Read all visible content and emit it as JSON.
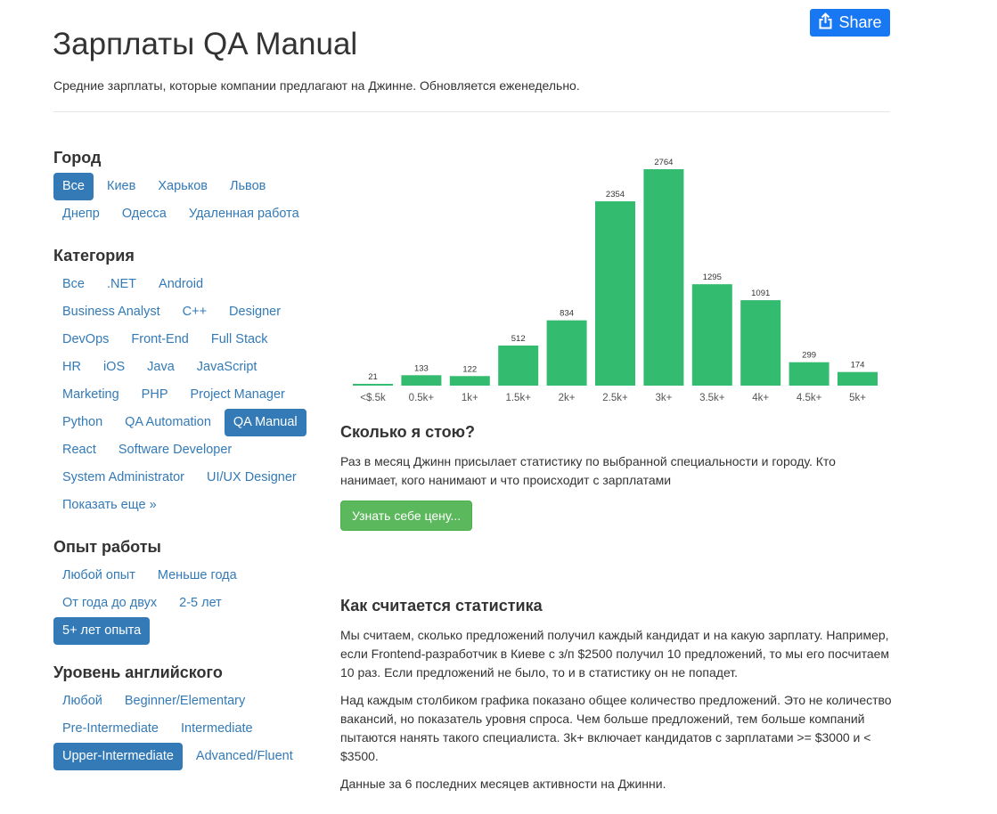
{
  "share": {
    "label": "Share",
    "icon": "share-icon"
  },
  "header": {
    "title": "Зарплаты QA Manual",
    "subtitle": "Средние зарплаты, которые компании предлагают на Джинне. Обновляется еженедельно."
  },
  "filters": {
    "city": {
      "heading": "Город",
      "items": [
        {
          "label": "Все",
          "active": true
        },
        {
          "label": "Киев",
          "active": false
        },
        {
          "label": "Харьков",
          "active": false
        },
        {
          "label": "Львов",
          "active": false
        },
        {
          "label": "Днепр",
          "active": false
        },
        {
          "label": "Одесса",
          "active": false
        },
        {
          "label": "Удаленная работа",
          "active": false
        }
      ]
    },
    "category": {
      "heading": "Категория",
      "items": [
        {
          "label": "Все",
          "active": false
        },
        {
          "label": ".NET",
          "active": false
        },
        {
          "label": "Android",
          "active": false
        },
        {
          "label": "Business Analyst",
          "active": false
        },
        {
          "label": "C++",
          "active": false
        },
        {
          "label": "Designer",
          "active": false
        },
        {
          "label": "DevOps",
          "active": false
        },
        {
          "label": "Front-End",
          "active": false
        },
        {
          "label": "Full Stack",
          "active": false
        },
        {
          "label": "HR",
          "active": false
        },
        {
          "label": "iOS",
          "active": false
        },
        {
          "label": "Java",
          "active": false
        },
        {
          "label": "JavaScript",
          "active": false
        },
        {
          "label": "Marketing",
          "active": false
        },
        {
          "label": "PHP",
          "active": false
        },
        {
          "label": "Project Manager",
          "active": false
        },
        {
          "label": "Python",
          "active": false
        },
        {
          "label": "QA Automation",
          "active": false
        },
        {
          "label": "QA Manual",
          "active": true
        },
        {
          "label": "React",
          "active": false
        },
        {
          "label": "Software Developer",
          "active": false
        },
        {
          "label": "System Administrator",
          "active": false
        },
        {
          "label": "UI/UX Designer",
          "active": false
        },
        {
          "label": "Показать еще »",
          "active": false
        }
      ]
    },
    "experience": {
      "heading": "Опыт работы",
      "items": [
        {
          "label": "Любой опыт",
          "active": false
        },
        {
          "label": "Меньше года",
          "active": false
        },
        {
          "label": "От года до двух",
          "active": false
        },
        {
          "label": "2-5 лет",
          "active": false
        },
        {
          "label": "5+ лет опыта",
          "active": true
        }
      ]
    },
    "english": {
      "heading": "Уровень английского",
      "items": [
        {
          "label": "Любой",
          "active": false
        },
        {
          "label": "Beginner/Elementary",
          "active": false
        },
        {
          "label": "Pre-Intermediate",
          "active": false
        },
        {
          "label": "Intermediate",
          "active": false
        },
        {
          "label": "Upper-Intermediate",
          "active": true
        },
        {
          "label": "Advanced/Fluent",
          "active": false
        }
      ]
    }
  },
  "chart_data": {
    "type": "bar",
    "categories": [
      "<$.5k",
      "0.5k+",
      "1k+",
      "1.5k+",
      "2k+",
      "2.5k+",
      "3k+",
      "3.5k+",
      "4k+",
      "4.5k+",
      "5k+"
    ],
    "values": [
      21,
      133,
      122,
      512,
      834,
      2354,
      2764,
      1295,
      1091,
      299,
      174
    ],
    "color": "#33bb6f",
    "title": "",
    "xlabel": "",
    "ylabel": "",
    "ylim": [
      0,
      2764
    ],
    "grid": false
  },
  "cost": {
    "heading": "Сколько я стою?",
    "text": "Раз в месяц Джинн присылает статистику по выбранной специальности и городу. Кто нанимает, кого нанимают и что происходит с зарплатами",
    "button": "Узнать себе цену..."
  },
  "method": {
    "heading": "Как считается статистика",
    "p1": "Мы считаем, сколько предложений получил каждый кандидат и на какую зарплату. Например, если Frontend-разработчик в Киеве с з/п $2500 получил 10 предложений, то мы его посчитаем 10 раз. Если предложений не было, то и в статистику он не попадет.",
    "p2": "Над каждым столбиком графика показано общее количество предложений. Это не количество вакансий, но показатель уровня спроса. Чем больше предложений, тем больше компаний пытаются нанять такого специалиста. 3k+ включает кандидатов с зарплатами >= $3000 и < $3500.",
    "p3": "Данные за 6 последних месяцев активности на Джинни."
  }
}
